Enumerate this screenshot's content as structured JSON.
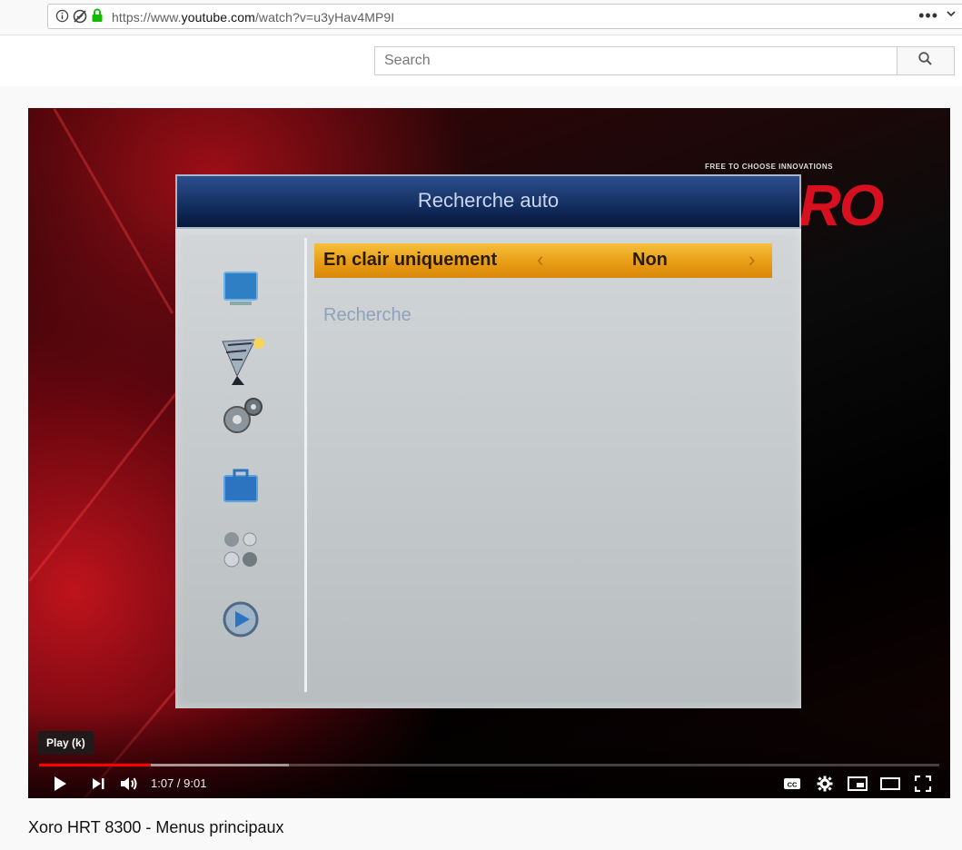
{
  "browser": {
    "url_prefix": "https://www.",
    "url_host": "youtube.com",
    "url_path": "/watch?v=u3yHav4MP9I",
    "page_actions_label": "•••"
  },
  "header": {
    "search_placeholder": "Search"
  },
  "video": {
    "osd": {
      "title": "Recherche auto",
      "row_label": "En clair uniquement",
      "row_value": "Non",
      "row_prev": "‹",
      "row_next": "›",
      "item2": "Recherche"
    },
    "brand_tag": "FREE TO CHOOSE INNOVATIONS",
    "brand_logo": "XORO"
  },
  "player": {
    "tooltip": "Play (k)",
    "current_time": "1:07",
    "time_separator": " / ",
    "duration": "9:01",
    "played_fraction": 0.124,
    "buffered_fraction": 0.278
  },
  "title": "Xoro HRT 8300 - Menus principaux"
}
